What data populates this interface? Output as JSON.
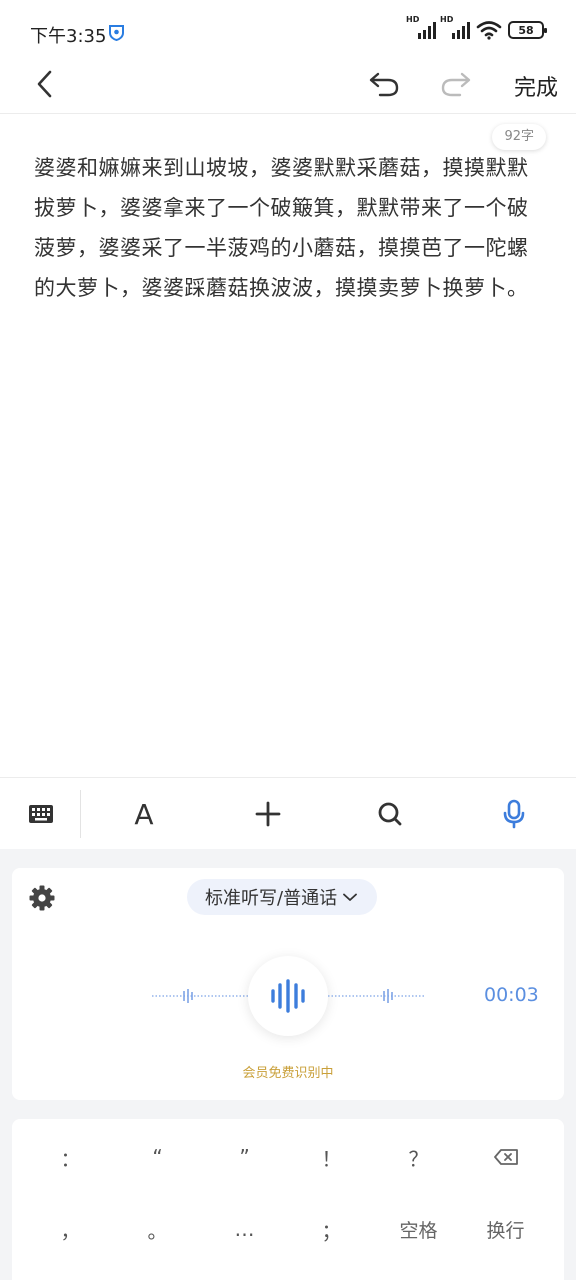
{
  "status": {
    "time": "下午3:35",
    "battery": "58",
    "signal_label": "HD"
  },
  "toolbar": {
    "done_label": "完成"
  },
  "document": {
    "word_count": "92字",
    "content": "婆婆和嫲嫲来到山坡坡，婆婆默默采蘑菇，摸摸默默拔萝卜，婆婆拿来了一个破簸箕，默默带来了一个破菠萝，婆婆采了一半菠鸡的小蘑菇，摸摸芭了一陀螺的大萝卜，婆婆踩蘑菇换波波，摸摸卖萝卜换萝卜。"
  },
  "format_bar": {
    "font_label": "A",
    "accent_color": "#3d7ddc"
  },
  "voice": {
    "mode": "标准听写/普通话",
    "timer": "00:03",
    "note": "会员免费识别中",
    "note_color": "#c9a03a"
  },
  "keyboard": {
    "row1": [
      "：",
      "“",
      "”",
      "！",
      "？"
    ],
    "row2": [
      "，",
      "。",
      "…",
      "；",
      "空格",
      "换行"
    ]
  }
}
